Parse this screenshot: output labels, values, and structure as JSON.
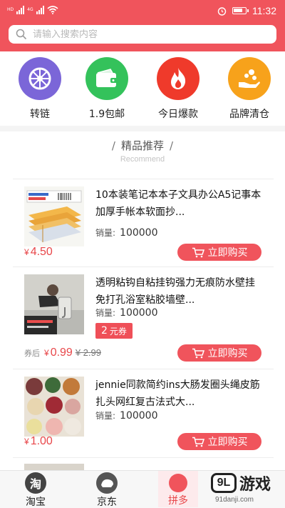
{
  "status_bar": {
    "time": "11:32",
    "network_tags": [
      "HD",
      "4G"
    ]
  },
  "search": {
    "placeholder": "请输入搜索内容"
  },
  "categories": [
    {
      "label": "转链",
      "color": "#7b66d8",
      "icon": "wheel-icon"
    },
    {
      "label": "1.9包邮",
      "color": "#34c25b",
      "icon": "wallet-icon"
    },
    {
      "label": "今日爆款",
      "color": "#ef3a2b",
      "icon": "fire-icon"
    },
    {
      "label": "品牌清仓",
      "color": "#f7a21b",
      "icon": "coins-hand-icon"
    }
  ],
  "section": {
    "title": "精品推荐",
    "slash": "/",
    "subtitle": "Recommend"
  },
  "products": [
    {
      "title": "10本装笔记本本子文具办公A5记事本加厚手帐本软面抄...",
      "sales_label": "销量:",
      "sales": "100000",
      "currency": "¥",
      "price": "4.50",
      "buy_label": "立即购买"
    },
    {
      "title": "透明粘钩自粘挂钩强力无痕防水壁挂免打孔浴室粘胶墙壁...",
      "sales_label": "销量:",
      "sales": "100000",
      "coupon_amount": "2",
      "coupon_unit": "元券",
      "after_label": "券后",
      "currency": "¥",
      "price": "0.99",
      "original_price": "¥ 2.99",
      "buy_label": "立即购买"
    },
    {
      "title": "jennie同款简约ins大肠发圈头绳皮筋扎头网红复古法式大...",
      "sales_label": "销量:",
      "sales": "100000",
      "currency": "¥",
      "price": "1.00",
      "buy_label": "立即购买"
    }
  ],
  "bottom_nav": [
    {
      "label": "淘宝",
      "icon_text": "淘"
    },
    {
      "label": "京东",
      "icon_text": ""
    },
    {
      "label": "拼多",
      "icon_text": ""
    }
  ],
  "watermark": {
    "logo_text": "9L",
    "brand": "游戏",
    "url": "91danji.com"
  }
}
